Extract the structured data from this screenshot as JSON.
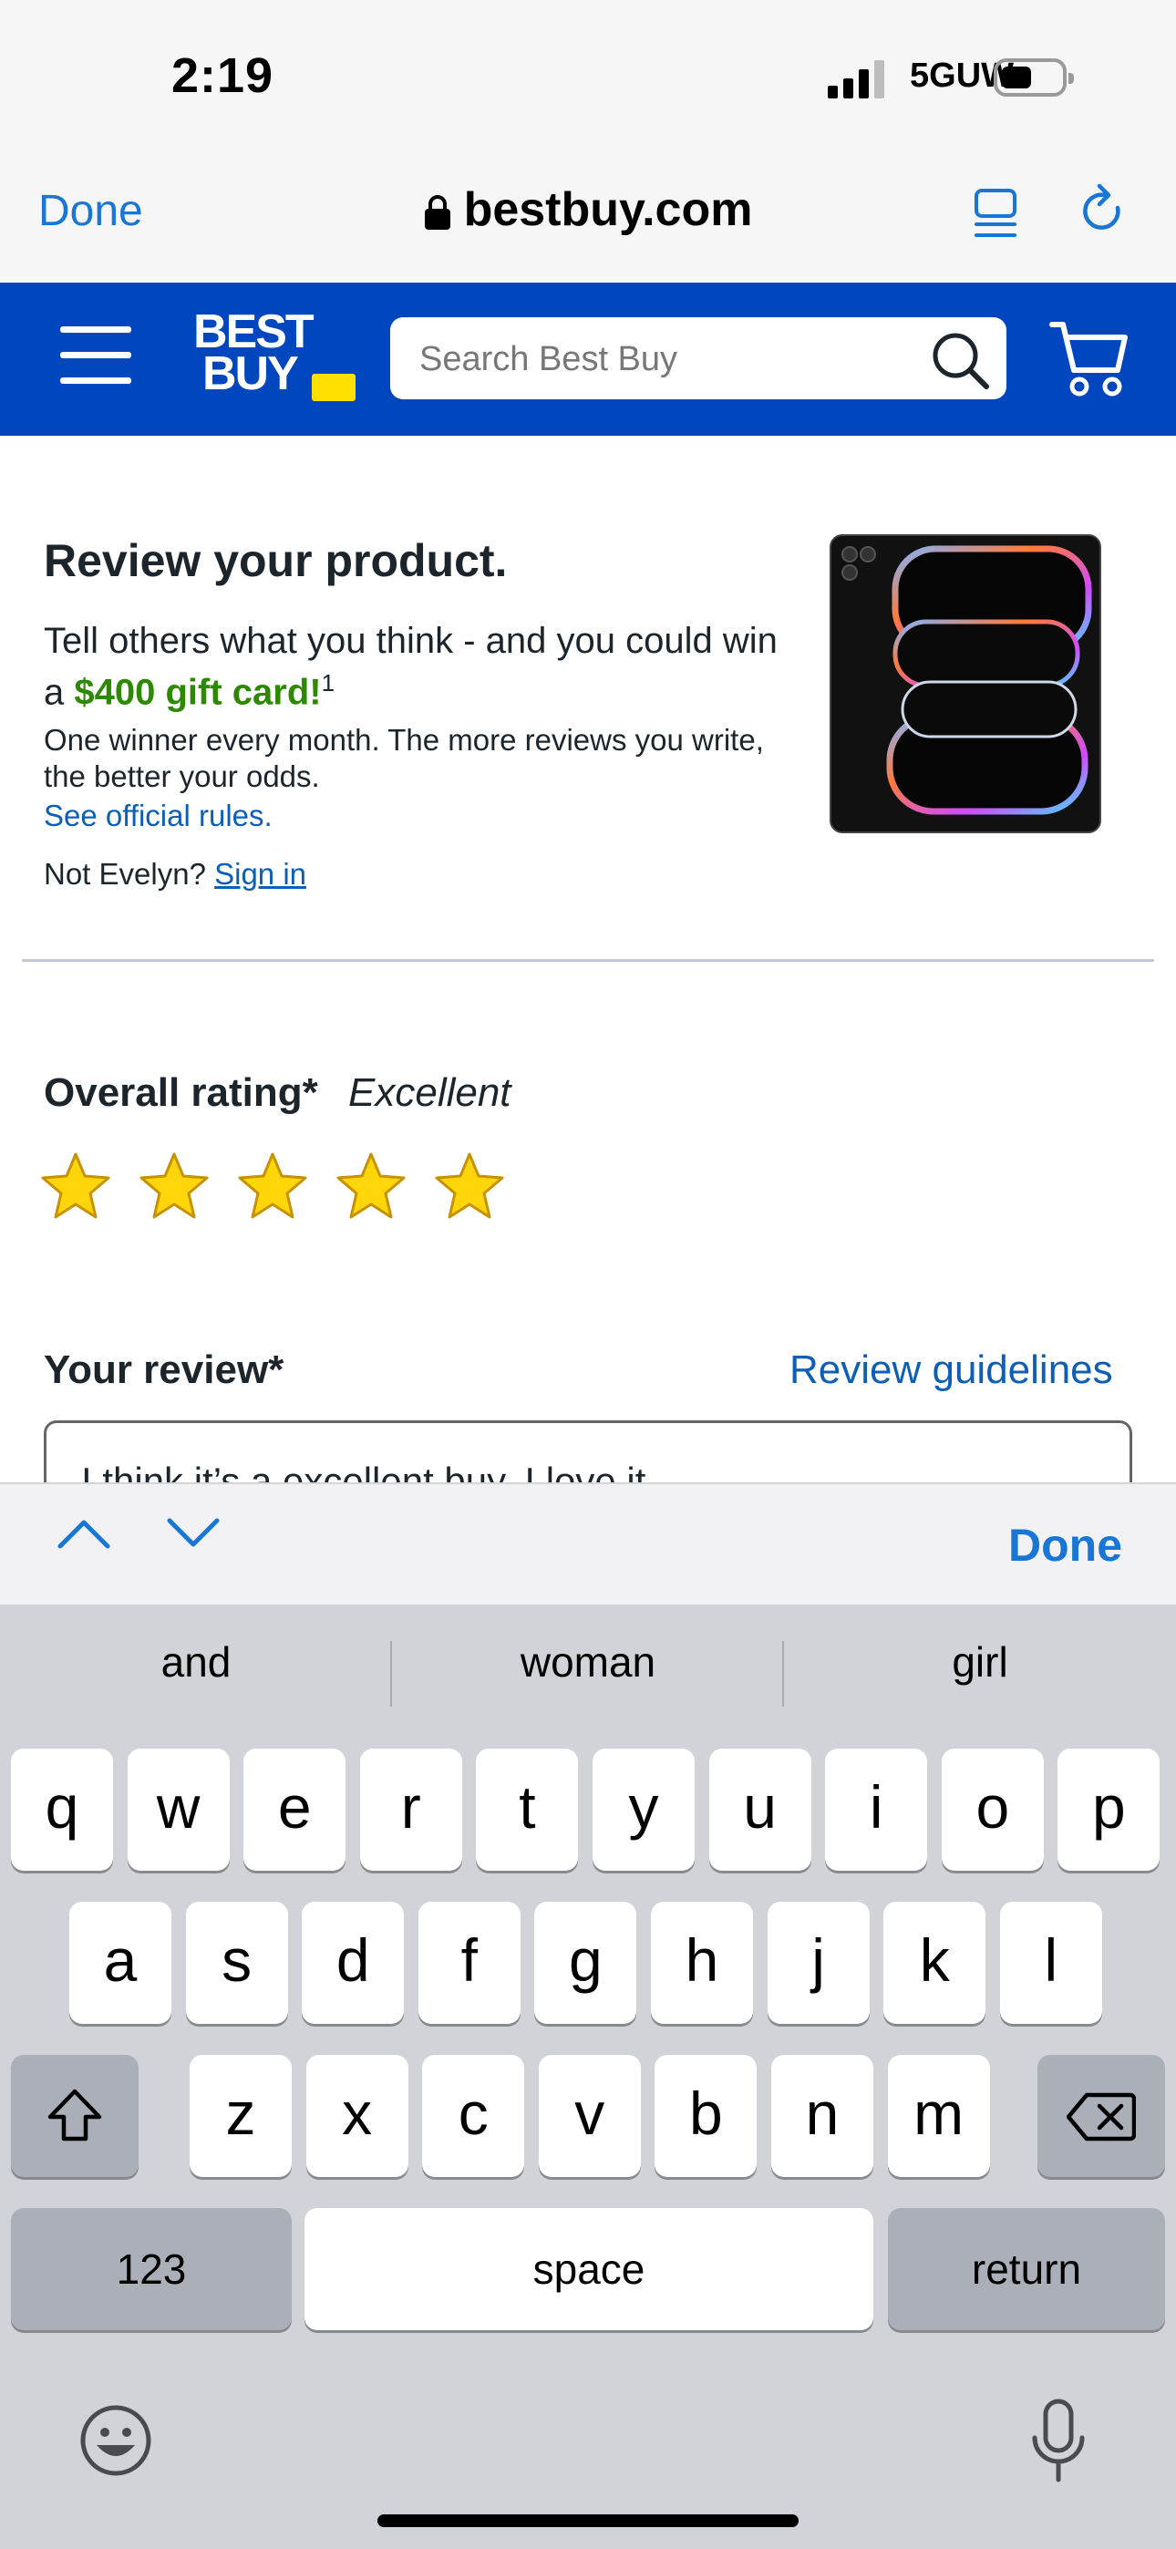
{
  "status": {
    "time": "2:19",
    "network": "5GUW"
  },
  "browser": {
    "done": "Done",
    "domain": "bestbuy.com"
  },
  "header": {
    "logo_line1": "BEST",
    "logo_line2": "BUY",
    "search_placeholder": "Search Best Buy",
    "brand_color": "#0046be",
    "tag_color": "#ffe000"
  },
  "review_intro": {
    "title": "Review your product.",
    "sub_before": "Tell others what you think - and you could win a ",
    "gift": "$400 gift card!",
    "sup": "1",
    "small": "One winner every month. The more reviews you write, the better your odds.",
    "rules": "See official rules.",
    "not_user": "Not Evelyn?",
    "sign_in": "Sign in"
  },
  "rating": {
    "label": "Overall rating*",
    "value_text": "Excellent",
    "stars": 5,
    "max": 5
  },
  "review": {
    "label": "Your review*",
    "guidelines": "Review guidelines",
    "text": "I think it’s a  excellent buy. I love it"
  },
  "accessory": {
    "done": "Done"
  },
  "keyboard": {
    "suggestions": [
      "and",
      "woman",
      "girl"
    ],
    "row1": [
      "q",
      "w",
      "e",
      "r",
      "t",
      "y",
      "u",
      "i",
      "o",
      "p"
    ],
    "row2": [
      "a",
      "s",
      "d",
      "f",
      "g",
      "h",
      "j",
      "k",
      "l"
    ],
    "row3": [
      "z",
      "x",
      "c",
      "v",
      "b",
      "n",
      "m"
    ],
    "numbers": "123",
    "space": "space",
    "return": "return"
  }
}
